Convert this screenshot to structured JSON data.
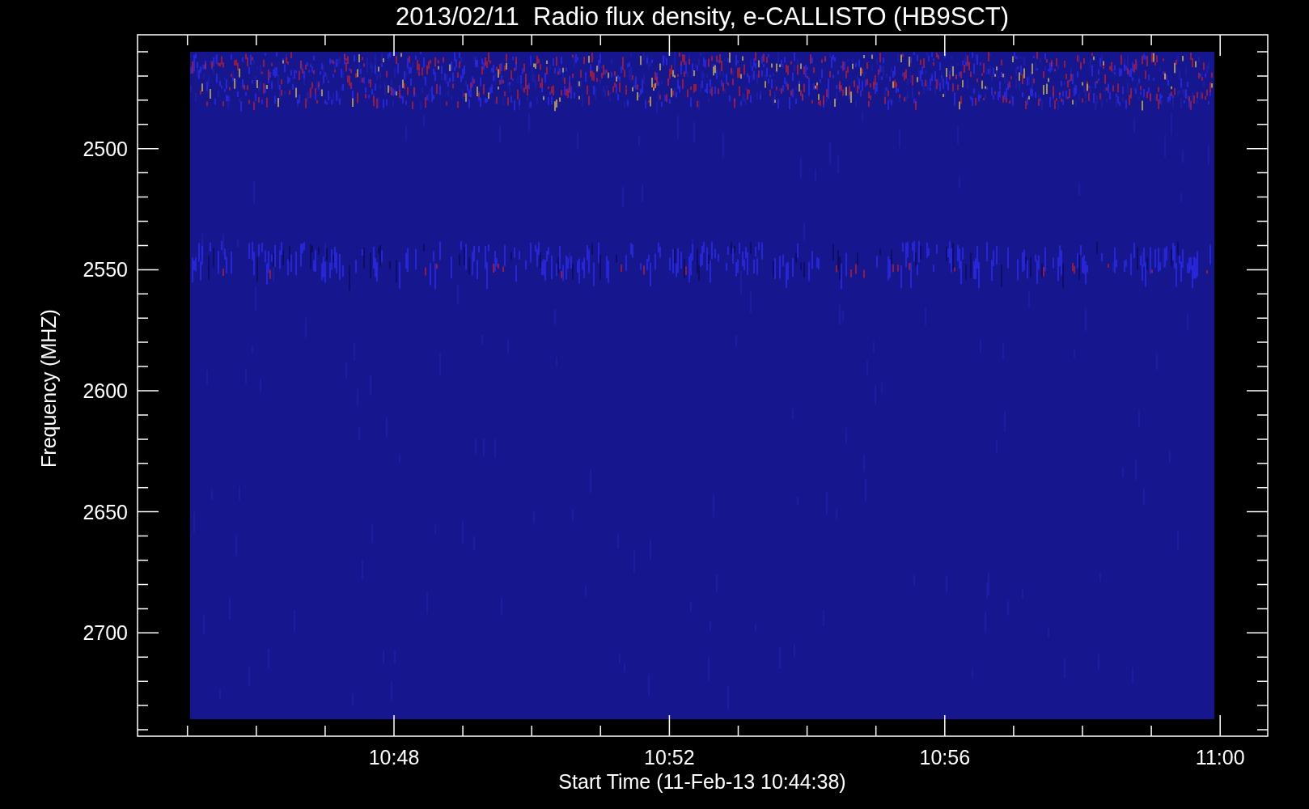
{
  "title": "2013/02/11  Radio flux density, e-CALLISTO (HB9SCT)",
  "plot": {
    "ylabel": "Frequency (MHZ)",
    "xlabel": "Start Time (11-Feb-13 10:44:38)",
    "yticks": [
      "2500",
      "2550",
      "2600",
      "2650",
      "2700"
    ],
    "xticks": [
      "10:48",
      "10:52",
      "10:56",
      "11:00"
    ]
  }
}
